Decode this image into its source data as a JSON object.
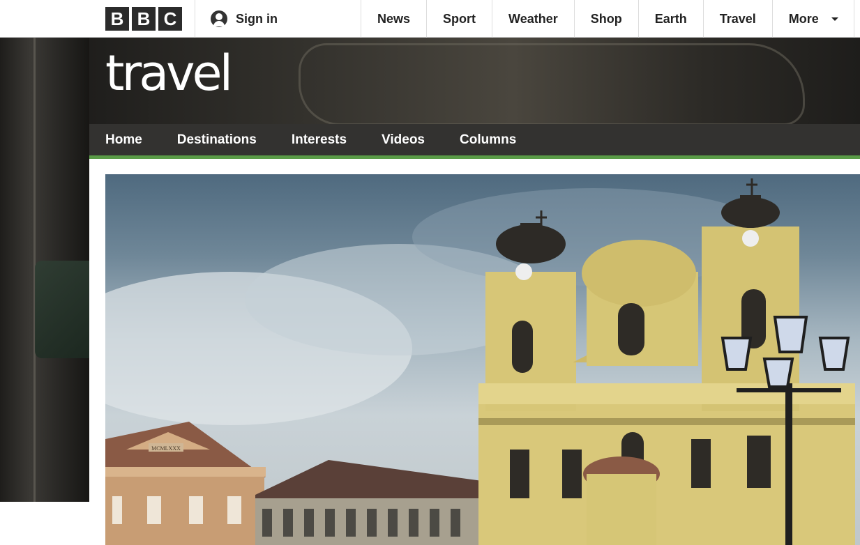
{
  "bbc_bar": {
    "logo_letters": [
      "B",
      "B",
      "C"
    ],
    "signin_label": "Sign in",
    "nav": [
      {
        "label": "News"
      },
      {
        "label": "Sport"
      },
      {
        "label": "Weather"
      },
      {
        "label": "Shop"
      },
      {
        "label": "Earth"
      },
      {
        "label": "Travel"
      },
      {
        "label": "More"
      }
    ]
  },
  "brand": {
    "wordmark": "travel"
  },
  "section_nav": {
    "tabs": [
      {
        "label": "Home"
      },
      {
        "label": "Destinations"
      },
      {
        "label": "Interests"
      },
      {
        "label": "Videos"
      },
      {
        "label": "Columns"
      }
    ],
    "accent_color": "#5a9b47"
  },
  "hero": {
    "building_plaque": "MCMLXXX"
  },
  "icons": {
    "signin": "user-avatar-icon",
    "more": "chevron-down-icon"
  }
}
